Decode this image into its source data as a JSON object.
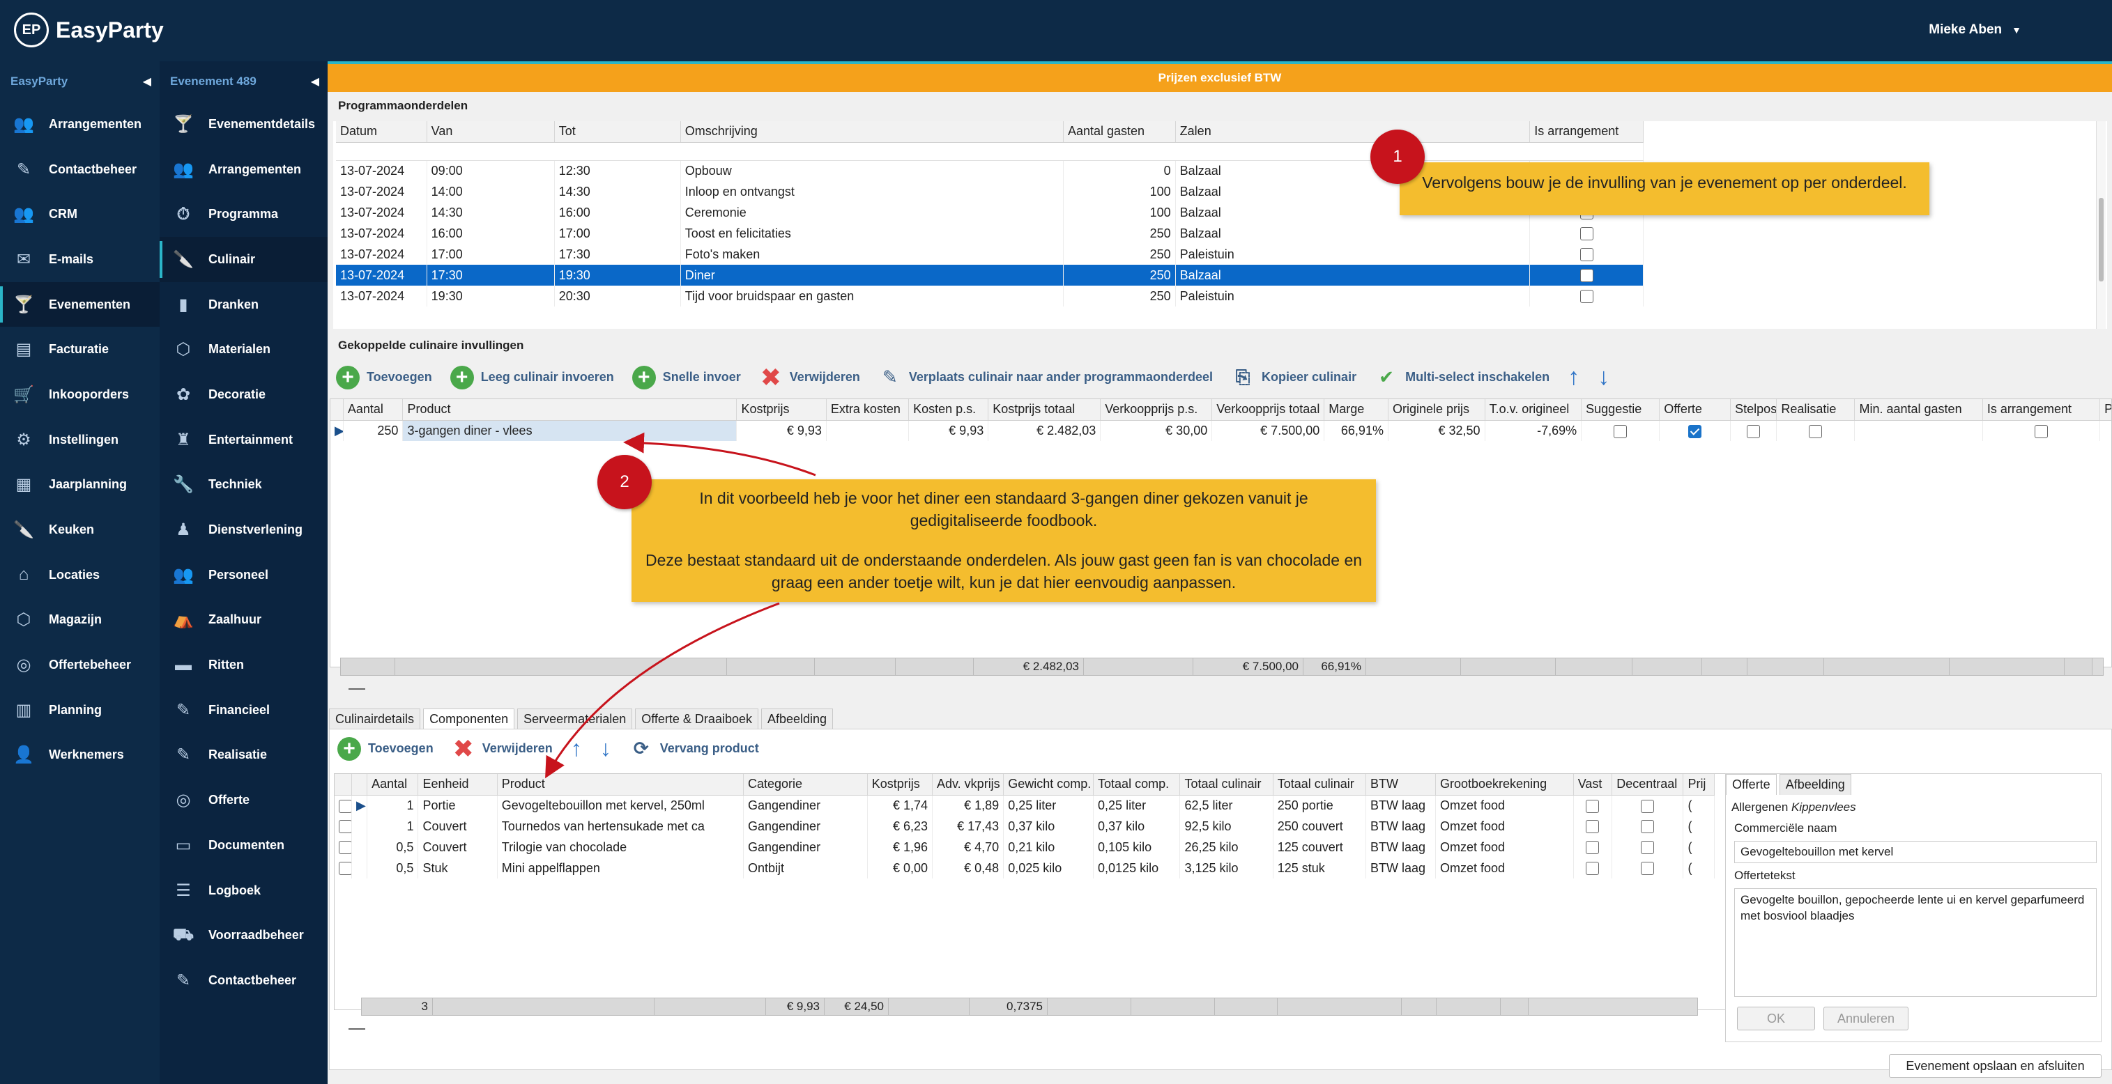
{
  "app": {
    "brand_logo": "EP",
    "brand_name": "EasyParty",
    "user_name": "Mieke Aben"
  },
  "sidebar": {
    "title": "EasyParty",
    "items": [
      {
        "label": "Arrangementen",
        "icon": "people-icon"
      },
      {
        "label": "Contactbeheer",
        "icon": "edit-icon"
      },
      {
        "label": "CRM",
        "icon": "people-icon"
      },
      {
        "label": "E-mails",
        "icon": "mail-icon"
      },
      {
        "label": "Evenementen",
        "icon": "cocktail-icon"
      },
      {
        "label": "Facturatie",
        "icon": "invoice-icon"
      },
      {
        "label": "Inkooporders",
        "icon": "cart-icon"
      },
      {
        "label": "Instellingen",
        "icon": "gear-icon"
      },
      {
        "label": "Jaarplanning",
        "icon": "calendar-icon"
      },
      {
        "label": "Keuken",
        "icon": "knife-icon"
      },
      {
        "label": "Locaties",
        "icon": "home-icon"
      },
      {
        "label": "Magazijn",
        "icon": "box-icon"
      },
      {
        "label": "Offertebeheer",
        "icon": "money-icon"
      },
      {
        "label": "Planning",
        "icon": "planning-icon"
      },
      {
        "label": "Werknemers",
        "icon": "person-icon"
      }
    ]
  },
  "subnav": {
    "title": "Evenement 489",
    "items": [
      {
        "label": "Evenementdetails",
        "icon": "cocktail-icon"
      },
      {
        "label": "Arrangementen",
        "icon": "people-icon"
      },
      {
        "label": "Programma",
        "icon": "stopwatch-icon"
      },
      {
        "label": "Culinair",
        "icon": "knife-icon"
      },
      {
        "label": "Dranken",
        "icon": "bottle-icon"
      },
      {
        "label": "Materialen",
        "icon": "box-icon"
      },
      {
        "label": "Decoratie",
        "icon": "flower-icon"
      },
      {
        "label": "Entertainment",
        "icon": "entertainer-icon"
      },
      {
        "label": "Techniek",
        "icon": "wrench-icon"
      },
      {
        "label": "Dienstverlening",
        "icon": "waiter-icon"
      },
      {
        "label": "Personeel",
        "icon": "people-icon"
      },
      {
        "label": "Zaalhuur",
        "icon": "hall-icon"
      },
      {
        "label": "Ritten",
        "icon": "bus-icon"
      },
      {
        "label": "Financieel",
        "icon": "edit-icon"
      },
      {
        "label": "Realisatie",
        "icon": "edit-icon"
      },
      {
        "label": "Offerte",
        "icon": "money-icon"
      },
      {
        "label": "Documenten",
        "icon": "folder-icon"
      },
      {
        "label": "Logboek",
        "icon": "logbook-icon"
      },
      {
        "label": "Voorraadbeheer",
        "icon": "forklift-icon"
      },
      {
        "label": "Contactbeheer",
        "icon": "edit-icon"
      }
    ]
  },
  "banner": "Prijzen exclusief BTW",
  "program": {
    "title": "Programmaonderdelen",
    "columns": [
      "Datum",
      "Van",
      "Tot",
      "Omschrijving",
      "Aantal gasten",
      "Zalen",
      "Is arrangement"
    ],
    "rows": [
      [
        "13-07-2024",
        "09:00",
        "12:30",
        "Opbouw",
        "0",
        "Balzaal"
      ],
      [
        "13-07-2024",
        "14:00",
        "14:30",
        "Inloop en ontvangst",
        "100",
        "Balzaal"
      ],
      [
        "13-07-2024",
        "14:30",
        "16:00",
        "Ceremonie",
        "100",
        "Balzaal"
      ],
      [
        "13-07-2024",
        "16:00",
        "17:00",
        "Toost en felicitaties",
        "250",
        "Balzaal"
      ],
      [
        "13-07-2024",
        "17:00",
        "17:30",
        "Foto's maken",
        "250",
        "Paleistuin"
      ],
      [
        "13-07-2024",
        "17:30",
        "19:30",
        "Diner",
        "250",
        "Balzaal"
      ],
      [
        "13-07-2024",
        "19:30",
        "20:30",
        "Tijd voor bruidspaar en gasten",
        "250",
        "Paleistuin"
      ]
    ]
  },
  "culinary": {
    "title": "Gekoppelde culinaire invullingen",
    "toolbar": [
      "Toevoegen",
      "Leeg culinair invoeren",
      "Snelle invoer",
      "Verwijderen",
      "Verplaats culinair naar ander programmaonderdeel",
      "Kopieer culinair",
      "Multi-select inschakelen"
    ],
    "columns": [
      "Aantal",
      "Product",
      "Kostprijs",
      "Extra kosten",
      "Kosten p.s.",
      "Kostprijs totaal",
      "Verkoopprijs p.s.",
      "Verkoopprijs totaal",
      "Marge",
      "Originele prijs",
      "T.o.v. origineel",
      "Suggestie",
      "Offerte",
      "Stelpost",
      "Realisatie",
      "Min. aantal gasten",
      "Is arrangement",
      "Pri"
    ],
    "row": [
      "250",
      "3-gangen diner - vlees",
      "€ 9,93",
      "",
      "€ 9,93",
      "€ 2.482,03",
      "€ 30,00",
      "€ 7.500,00",
      "66,91%",
      "€ 32,50",
      "-7,69%"
    ],
    "totals": {
      "kostprijs_totaal": "€ 2.482,03",
      "verkoopprijs_totaal": "€ 7.500,00",
      "marge": "66,91%"
    }
  },
  "detail_tabs": [
    "Culinairdetails",
    "Componenten",
    "Serveermaterialen",
    "Offerte & Draaiboek",
    "Afbeelding"
  ],
  "components": {
    "toolbar": [
      "Toevoegen",
      "Verwijderen",
      "Vervang product"
    ],
    "columns": [
      "Aantal",
      "Eenheid",
      "Product",
      "Categorie",
      "Kostprijs",
      "Adv. vkprijs",
      "Gewicht comp.",
      "Totaal comp.",
      "Totaal culinair",
      "Totaal culinair",
      "BTW",
      "Grootboekrekening",
      "Vast",
      "Decentraal",
      "Prij"
    ],
    "rows": [
      [
        "1",
        "Portie",
        "Gevogeltebouillon met kervel, 250ml",
        "Gangendiner",
        "€ 1,74",
        "€ 1,89",
        "0,25 liter",
        "0,25 liter",
        "62,5 liter",
        "250 portie",
        "BTW laag",
        "Omzet food"
      ],
      [
        "1",
        "Couvert",
        "Tournedos van hertensukade met ca",
        "Gangendiner",
        "€ 6,23",
        "€ 17,43",
        "0,37 kilo",
        "0,37 kilo",
        "92,5 kilo",
        "250 couvert",
        "BTW laag",
        "Omzet food"
      ],
      [
        "0,5",
        "Couvert",
        "Trilogie van chocolade",
        "Gangendiner",
        "€ 1,96",
        "€ 4,70",
        "0,21 kilo",
        "0,105 kilo",
        "26,25 kilo",
        "125 couvert",
        "BTW laag",
        "Omzet food"
      ],
      [
        "0,5",
        "Stuk",
        "Mini appelflappen",
        "Ontbijt",
        "€ 0,00",
        "€ 0,48",
        "0,025 kilo",
        "0,0125 kilo",
        "3,125 kilo",
        "125 stuk",
        "BTW laag",
        "Omzet food"
      ]
    ],
    "totals": {
      "aantal": "3",
      "kostprijs": "€ 9,93",
      "adv": "€ 24,50",
      "totaal_comp": "0,7375"
    }
  },
  "offer_panel": {
    "tabs": [
      "Offerte",
      "Afbeelding"
    ],
    "allergens_label": "Allergenen",
    "allergens_value": "Kippenvlees",
    "commercial_label": "Commerciële naam",
    "commercial_value": "Gevogeltebouillon met kervel",
    "offer_text_label": "Offertetekst",
    "offer_text": "Gevogelte bouillon, gepocheerde lente ui en kervel geparfumeerd met bosviool blaadjes",
    "ok": "OK",
    "cancel": "Annuleren"
  },
  "footer_button": "Evenement opslaan en afsluiten",
  "callouts": [
    {
      "num": "1",
      "text": "Vervolgens bouw je de invulling van je evenement op per onderdeel."
    },
    {
      "num": "2",
      "text1": "In dit voorbeeld heb je voor het diner een standaard 3-gangen diner gekozen vanuit je gedigitaliseerde foodbook.",
      "text2": "Deze bestaat standaard uit de onderstaande onderdelen. Als jouw gast geen fan is van chocolade en graag een ander toetje wilt, kun je dat hier eenvoudig aanpassen."
    }
  ],
  "colors": {
    "navy": "#0d2a47",
    "orange": "#f5a11b",
    "selection": "#0a68c8",
    "callout": "#f4bd2e",
    "badge": "#c7131c"
  }
}
